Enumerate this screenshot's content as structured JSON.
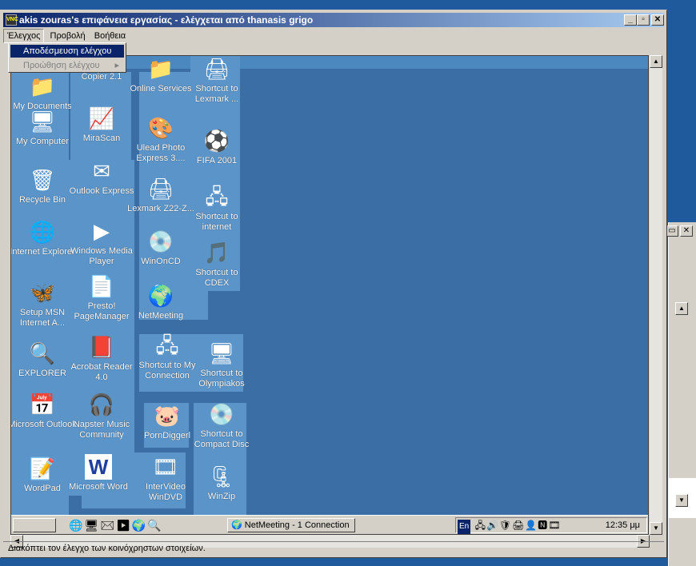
{
  "window": {
    "title": "akis zouras's επιφάνεια εργασίας - ελέγχεται από thanasis grigo",
    "app_icon": "vnc-viewer-icon"
  },
  "menu": {
    "items": [
      "Έλεγχος",
      "Προβολή",
      "Βοήθεια"
    ],
    "dropdown": {
      "selected": "Αποδέσμευση ελέγχου",
      "disabled": "Προώθηση ελέγχου"
    }
  },
  "desktop": {
    "icons": [
      {
        "label": "My Documents",
        "icon": "folder-documents-icon",
        "glyph": "📁"
      },
      {
        "label": "Copier 2.1",
        "icon": "copier-icon",
        "glyph": "📠"
      },
      {
        "label": "Online Services",
        "icon": "folder-icon",
        "glyph": "📁"
      },
      {
        "label": "Shortcut to Lexmark ...",
        "icon": "printer-icon",
        "glyph": "🖨"
      },
      {
        "label": "My Computer",
        "icon": "computer-icon",
        "glyph": "🖥"
      },
      {
        "label": "MiraScan",
        "icon": "scanner-icon",
        "glyph": "📈"
      },
      {
        "label": "Ulead Photo Express 3....",
        "icon": "photo-icon",
        "glyph": "🎨"
      },
      {
        "label": "FIFA 2001",
        "icon": "fifa-icon",
        "glyph": "⚽"
      },
      {
        "label": "Recycle Bin",
        "icon": "recycle-bin-icon",
        "glyph": "🗑"
      },
      {
        "label": "Outlook Express",
        "icon": "mail-icon",
        "glyph": "✉"
      },
      {
        "label": "Lexmark Z22-Z...",
        "icon": "printer-icon",
        "glyph": "🖨"
      },
      {
        "label": "Shortcut to internet",
        "icon": "network-icon",
        "glyph": "🖧"
      },
      {
        "label": "Internet Explorer",
        "icon": "ie-icon",
        "glyph": "🌐"
      },
      {
        "label": "Windows Media Player",
        "icon": "media-player-icon",
        "glyph": "▶"
      },
      {
        "label": "WinOnCD",
        "icon": "cd-icon",
        "glyph": "💿"
      },
      {
        "label": "Shortcut to CDEX",
        "icon": "cdex-icon",
        "glyph": "🎵"
      },
      {
        "label": "Setup MSN Internet A...",
        "icon": "msn-icon",
        "glyph": "🦋"
      },
      {
        "label": "Presto! PageManager",
        "icon": "pagemanager-icon",
        "glyph": "📄"
      },
      {
        "label": "NetMeeting",
        "icon": "netmeeting-icon",
        "glyph": "🌍"
      },
      {
        "label": "EXPLORER",
        "icon": "explorer-icon",
        "glyph": "🔍"
      },
      {
        "label": "Acrobat Reader 4.0",
        "icon": "acrobat-icon",
        "glyph": "📕"
      },
      {
        "label": "Shortcut to My Connection",
        "icon": "connection-icon",
        "glyph": "🖧"
      },
      {
        "label": "Shortcut to Olympiakos",
        "icon": "monitor-icon",
        "glyph": "🖥"
      },
      {
        "label": "Microsoft Outlook",
        "icon": "outlook-icon",
        "glyph": "📅"
      },
      {
        "label": "Napster Music Community",
        "icon": "napster-icon",
        "glyph": "🎧"
      },
      {
        "label": "PornDiggerl",
        "icon": "digger-icon",
        "glyph": "🐷"
      },
      {
        "label": "Shortcut to Compact Disc",
        "icon": "compact-disc-icon",
        "glyph": "💿"
      },
      {
        "label": "WordPad",
        "icon": "wordpad-icon",
        "glyph": "📝"
      },
      {
        "label": "Microsoft Word",
        "icon": "word-icon",
        "glyph": "W"
      },
      {
        "label": "InterVideo WinDVD",
        "icon": "dvd-icon",
        "glyph": "🎞"
      },
      {
        "label": "WinZip",
        "icon": "winzip-icon",
        "glyph": "🗜"
      }
    ]
  },
  "taskbar": {
    "task_label": "NetMeeting - 1 Connection",
    "language": "En",
    "clock": "12:35 μμ"
  },
  "status": {
    "text": "Διακόπτει τον έλεγχο των κοινόχρηστων στοιχείων."
  },
  "colors": {
    "desktop": "#3a6ea5",
    "title_start": "#0a246a",
    "title_end": "#a6caf0"
  }
}
